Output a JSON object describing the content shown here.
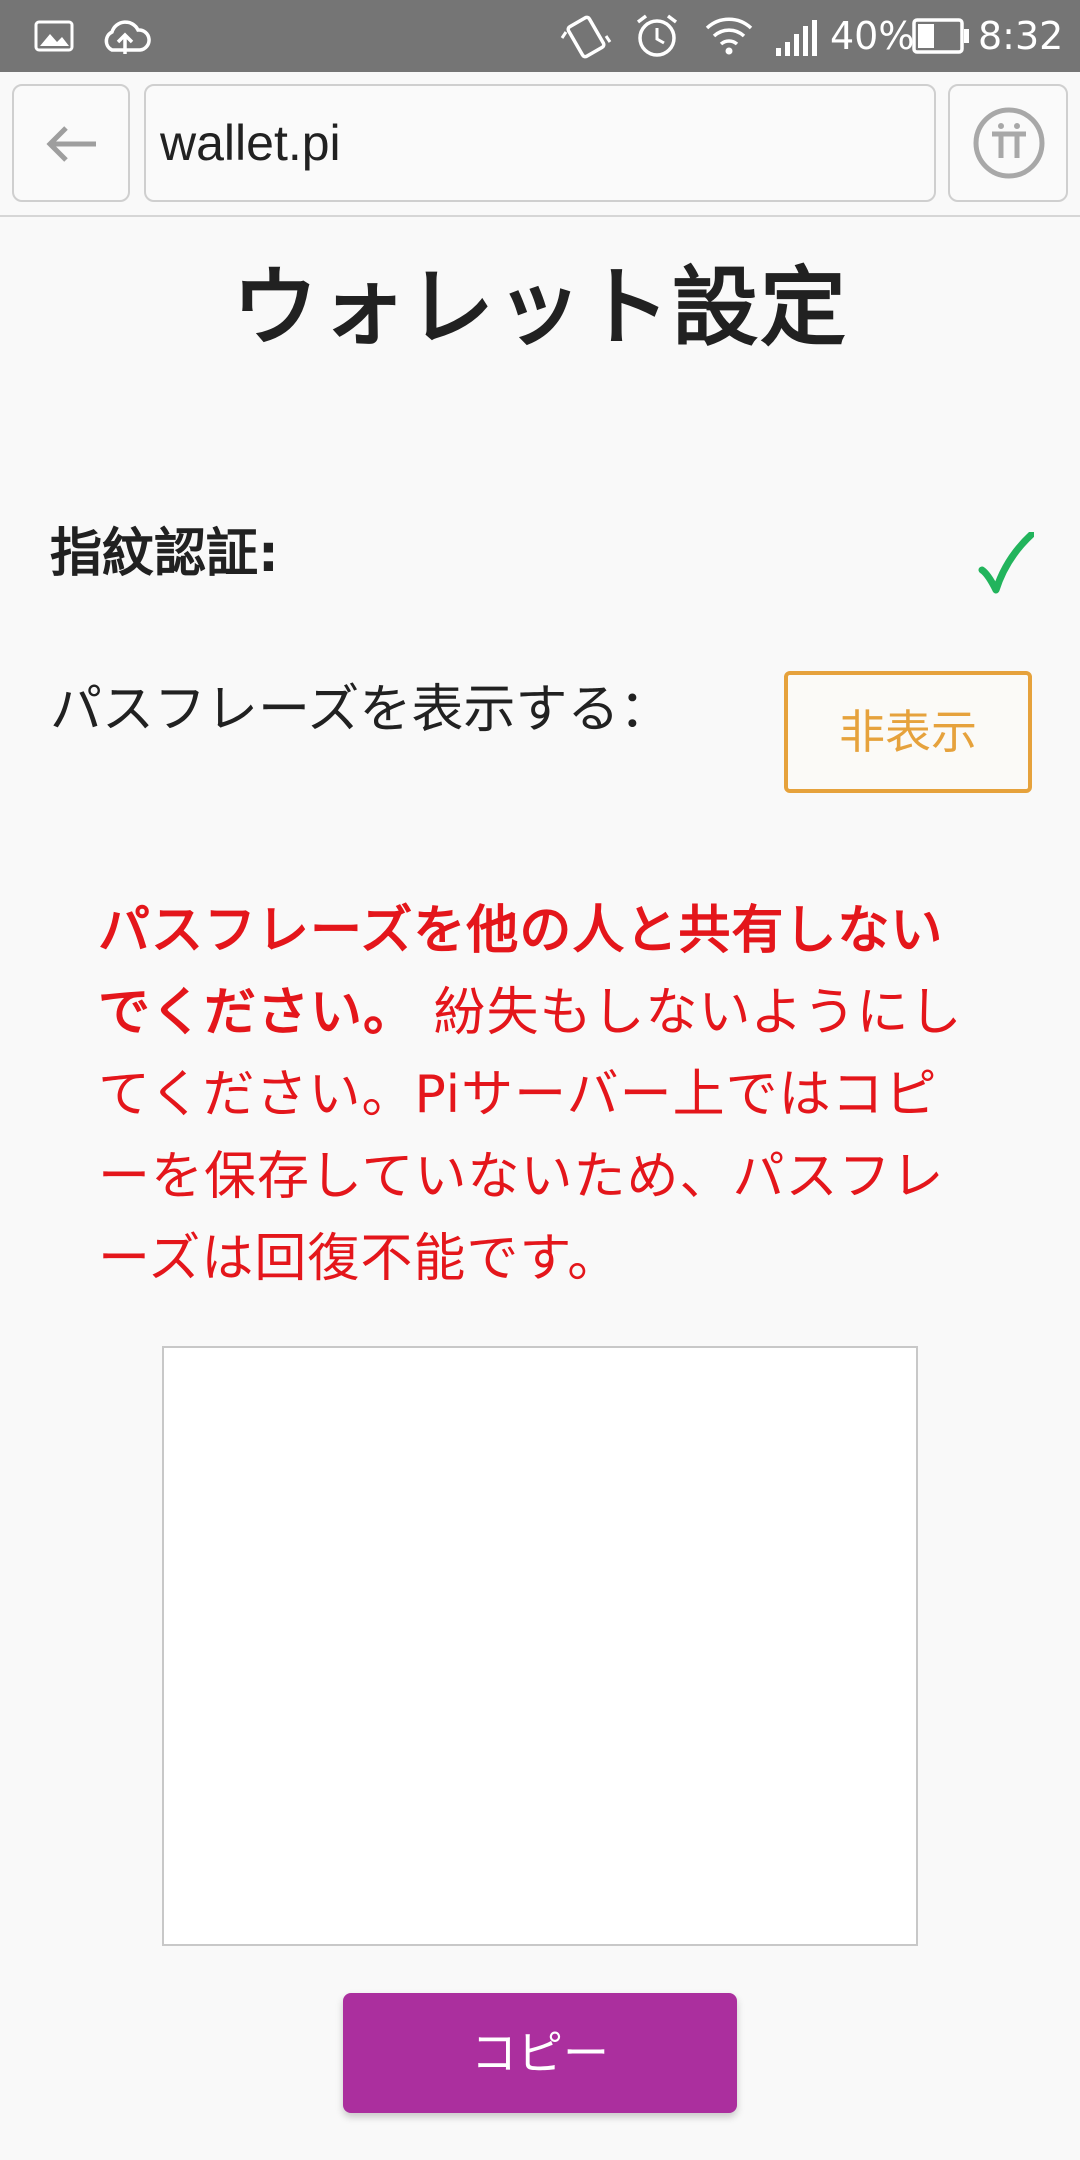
{
  "status_bar": {
    "battery_percent": "40%",
    "time": "8:32",
    "icons": [
      "gallery-icon",
      "cloud-upload-icon",
      "vibrate-icon",
      "alarm-icon",
      "wifi-icon",
      "signal-icon",
      "battery-icon"
    ]
  },
  "browser": {
    "url": "wallet.pi",
    "back_icon": "arrow-left-icon",
    "menu_icon": "pi-logo-icon"
  },
  "page": {
    "title": "ウォレット設定"
  },
  "settings": {
    "fingerprint_label": "指紋認証:",
    "fingerprint_enabled": true,
    "passphrase_label": "パスフレーズを表示する：",
    "hide_button_label": "非表示"
  },
  "warning": {
    "bold_text": "パスフレーズを他の人と共有しないでください。",
    "body_text": "紛失もしないようにしてください。Piサーバー上ではコピーを保存していないため、パスフレーズは回復不能です。"
  },
  "actions": {
    "copy_label": "コピー"
  },
  "colors": {
    "warning": "#e4161b",
    "hide_button": "#e6a23c",
    "copy_button": "#ab2f9e",
    "check": "#22b45c"
  }
}
